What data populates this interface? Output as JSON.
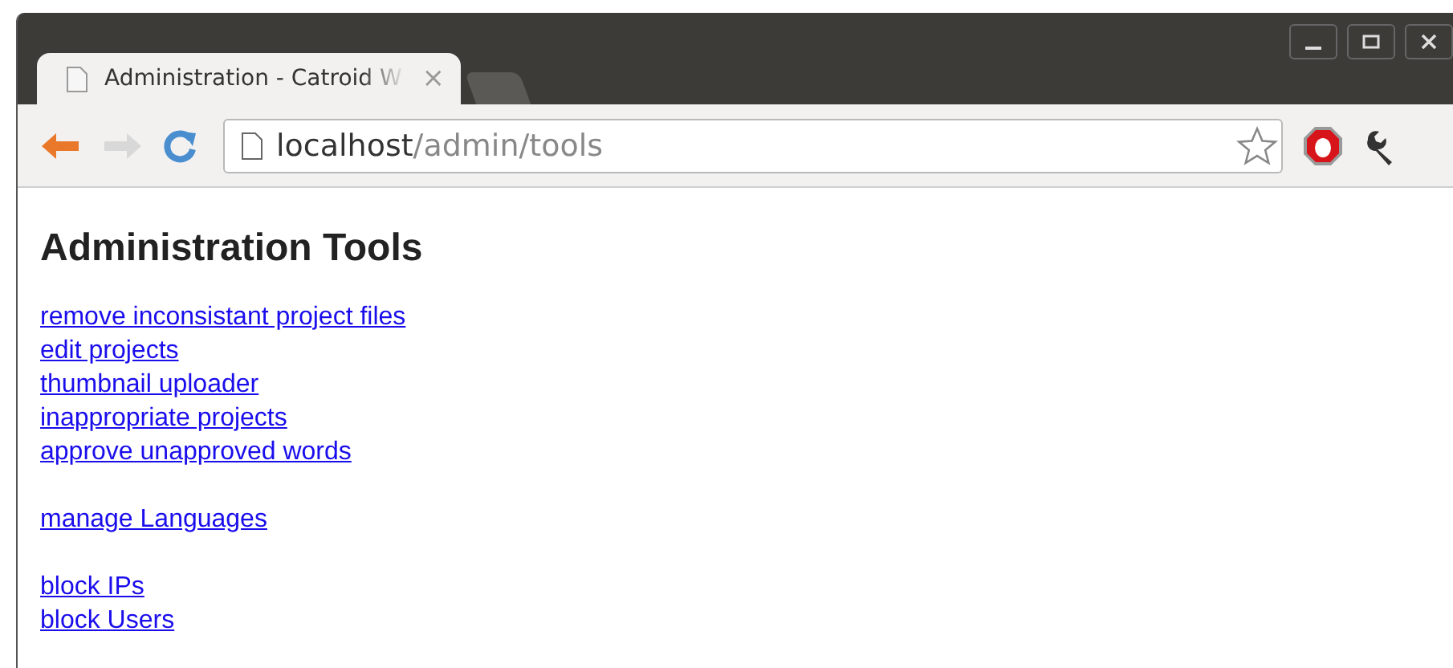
{
  "tabs": [
    {
      "title": "Administration - Catroid W",
      "selected": true,
      "close": "×"
    },
    {
      "selected": false
    }
  ],
  "address_bar": {
    "host": "localhost",
    "path": "/admin/tools"
  },
  "page": {
    "heading": "Administration Tools",
    "link_groups": [
      [
        "remove inconsistant project files",
        "edit projects",
        "thumbnail uploader",
        "inappropriate projects",
        "approve unapproved words"
      ],
      [
        "manage Languages"
      ],
      [
        "block IPs",
        "block Users"
      ]
    ]
  }
}
